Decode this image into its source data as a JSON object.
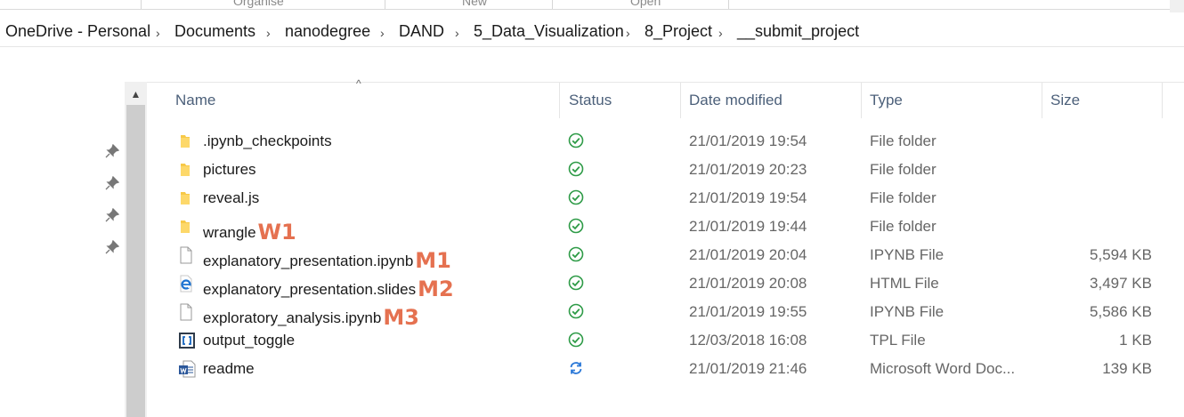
{
  "ribbon": {
    "groups": [
      "Organise",
      "New",
      "Open"
    ]
  },
  "breadcrumb": {
    "items": [
      "OneDrive - Personal",
      "Documents",
      "nanodegree",
      "DAND",
      "5_Data_Visualization",
      "8_Project",
      "__submit_project"
    ],
    "separator": "›"
  },
  "nav": {
    "scroll_up": "▲",
    "pin_glyph": "📌"
  },
  "columns": {
    "name": "Name",
    "status": "Status",
    "date_modified": "Date modified",
    "type": "Type",
    "size": "Size",
    "sort_indicator": "^"
  },
  "files": [
    {
      "name": ".ipynb_checkpoints",
      "icon": "folder-icon",
      "status": "synced",
      "date": "21/01/2019 19:54",
      "type": "File folder",
      "size": "",
      "annotation": ""
    },
    {
      "name": "pictures",
      "icon": "folder-icon",
      "status": "synced",
      "date": "21/01/2019 20:23",
      "type": "File folder",
      "size": "",
      "annotation": ""
    },
    {
      "name": "reveal.js",
      "icon": "folder-icon",
      "status": "synced",
      "date": "21/01/2019 19:54",
      "type": "File folder",
      "size": "",
      "annotation": ""
    },
    {
      "name": "wrangle",
      "icon": "folder-icon",
      "status": "synced",
      "date": "21/01/2019 19:44",
      "type": "File folder",
      "size": "",
      "annotation": "W1"
    },
    {
      "name": "explanatory_presentation.ipynb",
      "icon": "document-icon",
      "status": "synced",
      "date": "21/01/2019 20:04",
      "type": "IPYNB File",
      "size": "5,594 KB",
      "annotation": "M1"
    },
    {
      "name": "explanatory_presentation.slides",
      "icon": "edge-browser-icon",
      "status": "synced",
      "date": "21/01/2019 20:08",
      "type": "HTML File",
      "size": "3,497 KB",
      "annotation": "M2"
    },
    {
      "name": "exploratory_analysis.ipynb",
      "icon": "document-icon",
      "status": "synced",
      "date": "21/01/2019 19:55",
      "type": "IPYNB File",
      "size": "5,586 KB",
      "annotation": "M3"
    },
    {
      "name": "output_toggle",
      "icon": "bracket-file-icon",
      "status": "synced",
      "date": "12/03/2018 16:08",
      "type": "TPL File",
      "size": "1 KB",
      "annotation": ""
    },
    {
      "name": "readme",
      "icon": "word-document-icon",
      "status": "syncing",
      "date": "21/01/2019 21:46",
      "type": "Microsoft Word Doc...",
      "size": "139 KB",
      "annotation": ""
    }
  ],
  "colors": {
    "header_text": "#4c607a",
    "folder": "#f7c948",
    "synced": "#2e9b47",
    "syncing": "#2b79d8",
    "annotation": "#e57150",
    "word": "#2b579a"
  }
}
